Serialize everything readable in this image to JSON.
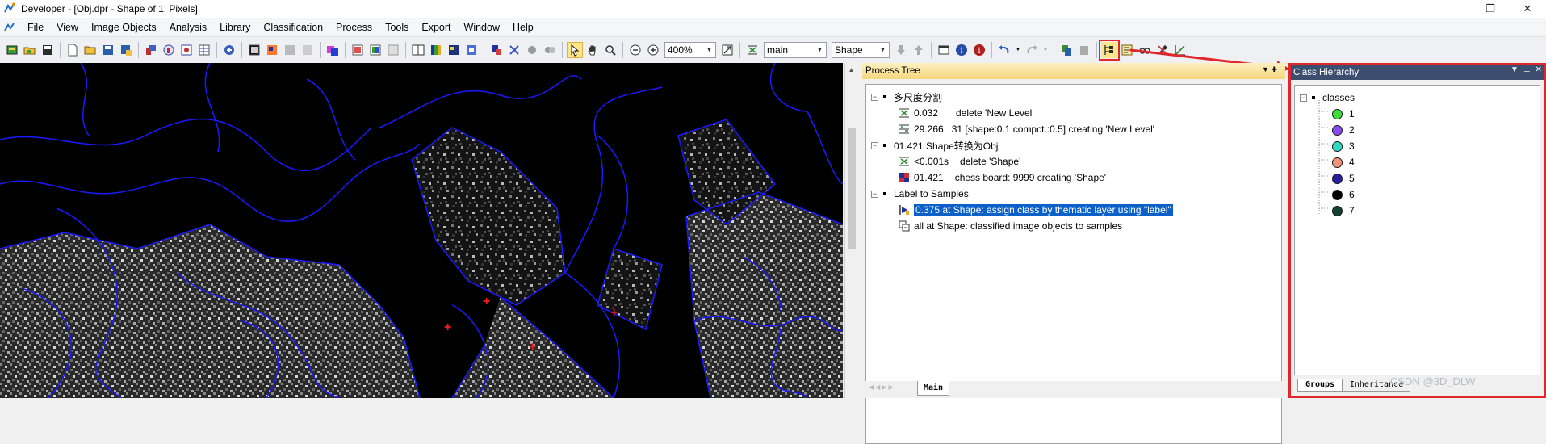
{
  "window": {
    "title": "Developer - [Obj.dpr - Shape of 1: Pixels]",
    "controls": [
      "—",
      "❐",
      "✕"
    ]
  },
  "menu": [
    "File",
    "View",
    "Image Objects",
    "Analysis",
    "Library",
    "Classification",
    "Process",
    "Tools",
    "Export",
    "Window",
    "Help"
  ],
  "toolbar": {
    "zoom_value": "400%",
    "level_value": "main",
    "shape_value": "Shape"
  },
  "process_tree": {
    "title": "Process Tree",
    "rows": [
      {
        "label": "多尺度分割"
      },
      {
        "time": "0.032",
        "text": "delete 'New Level'"
      },
      {
        "time": "29.266",
        "text": "31 [shape:0.1 compct.:0.5] creating 'New Level'"
      },
      {
        "label": "01.421    Shape转换为Obj"
      },
      {
        "time": "<0.001s",
        "text": "delete 'Shape'"
      },
      {
        "time": "01.421",
        "text": "chess board: 9999 creating 'Shape'"
      },
      {
        "label": "Label to Samples"
      },
      {
        "text": "0.375     at  Shape: assign class by thematic layer using \"label\""
      },
      {
        "text": "all at  Shape: classified image objects to samples"
      }
    ],
    "tab_main": "Main"
  },
  "class_hierarchy": {
    "title": "Class Hierarchy",
    "root": "classes",
    "classes": [
      {
        "name": "1",
        "color": "#3ddc3d"
      },
      {
        "name": "2",
        "color": "#8a4cf0"
      },
      {
        "name": "3",
        "color": "#33d8c0"
      },
      {
        "name": "4",
        "color": "#f2947a"
      },
      {
        "name": "5",
        "color": "#27209c"
      },
      {
        "name": "6",
        "color": "#000000"
      },
      {
        "name": "7",
        "color": "#13432e"
      }
    ],
    "tabs": [
      "Groups",
      "Inheritance"
    ]
  },
  "watermark": "CSDN @3D_DLW",
  "colors": {
    "highlight": "#e0262a",
    "selection": "#0c61c8",
    "object_outline": "#1a1aff"
  }
}
